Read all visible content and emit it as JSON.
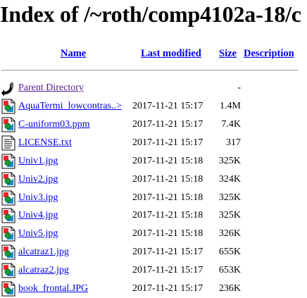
{
  "title": "Index of /~roth/comp4102a-18/c",
  "columns": {
    "name": "Name",
    "last_modified": "Last modified",
    "size": "Size",
    "description": "Description"
  },
  "parent": {
    "label": "Parent Directory",
    "size": "-",
    "icon": "back-arrow-icon"
  },
  "files": [
    {
      "name": "AquaTermi_lowcontras..>",
      "modified": "2017-11-21 15:17",
      "size": "1.4M",
      "icon": "image-icon"
    },
    {
      "name": "C-uniform03.ppm",
      "modified": "2017-11-21 15:17",
      "size": "7.4K",
      "icon": "image-icon"
    },
    {
      "name": "LICENSE.txt",
      "modified": "2017-11-21 15:17",
      "size": "317",
      "icon": "text-file-icon"
    },
    {
      "name": "Univ1.jpg",
      "modified": "2017-11-21 15:18",
      "size": "325K",
      "icon": "image-icon"
    },
    {
      "name": "Univ2.jpg",
      "modified": "2017-11-21 15:18",
      "size": "324K",
      "icon": "image-icon"
    },
    {
      "name": "Univ3.jpg",
      "modified": "2017-11-21 15:18",
      "size": "325K",
      "icon": "image-icon"
    },
    {
      "name": "Univ4.jpg",
      "modified": "2017-11-21 15:18",
      "size": "325K",
      "icon": "image-icon"
    },
    {
      "name": "Univ5.jpg",
      "modified": "2017-11-21 15:18",
      "size": "326K",
      "icon": "image-icon"
    },
    {
      "name": "alcatraz1.jpg",
      "modified": "2017-11-21 15:17",
      "size": "655K",
      "icon": "image-icon"
    },
    {
      "name": "alcatraz2.jpg",
      "modified": "2017-11-21 15:17",
      "size": "653K",
      "icon": "image-icon"
    },
    {
      "name": "book_frontal.JPG",
      "modified": "2017-11-21 15:17",
      "size": "236K",
      "icon": "image-icon"
    }
  ]
}
